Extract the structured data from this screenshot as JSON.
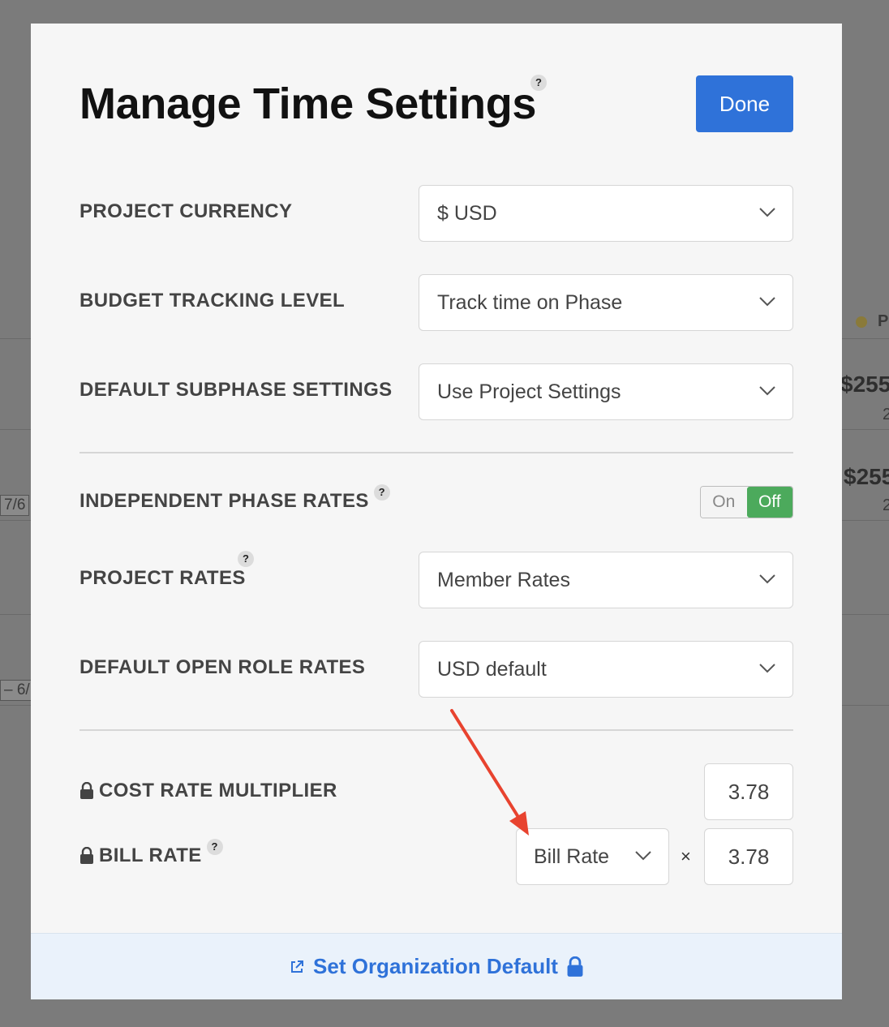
{
  "background": {
    "values": [
      "$255",
      "$255"
    ],
    "subvalues": [
      "2",
      "2"
    ],
    "dates": [
      "7/6",
      "–  6/"
    ],
    "legend_initial": "P"
  },
  "modal": {
    "title": "Manage Time Settings",
    "help_mark": "?",
    "done_label": "Done",
    "settings": [
      {
        "label": "PROJECT CURRENCY",
        "value": "$ USD"
      },
      {
        "label": "BUDGET TRACKING LEVEL",
        "value": "Track time on Phase"
      },
      {
        "label": "DEFAULT SUBPHASE SETTINGS",
        "value": "Use Project Settings"
      }
    ],
    "independent_phase_rates": {
      "label": "INDEPENDENT PHASE RATES",
      "on_label": "On",
      "off_label": "Off",
      "state": "Off"
    },
    "project_rates": {
      "label": "PROJECT RATES",
      "value": "Member Rates"
    },
    "default_open_role_rates": {
      "label": "DEFAULT OPEN ROLE RATES",
      "value": "USD default"
    },
    "cost_rate_multiplier": {
      "label": "COST RATE MULTIPLIER",
      "value": "3.78"
    },
    "bill_rate": {
      "label": "BILL RATE",
      "basis": "Bill Rate",
      "operator": "×",
      "multiplier": "3.78"
    },
    "footer_link": "Set Organization Default"
  },
  "colors": {
    "primary": "#2f72d9",
    "toggle_off": "#4caa5c",
    "annotation_arrow": "#e8432f"
  }
}
